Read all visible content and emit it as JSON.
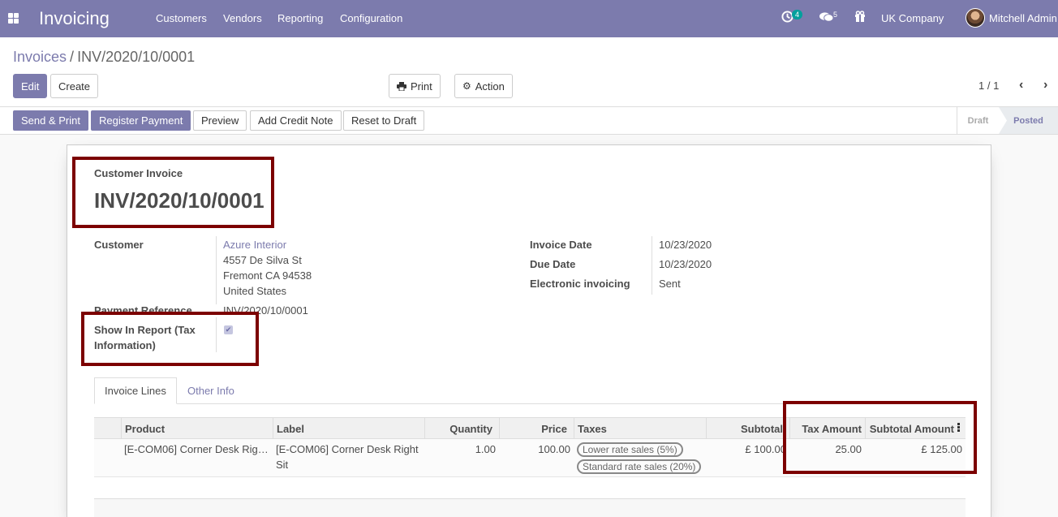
{
  "nav": {
    "brand": "Invoicing",
    "menu": [
      "Customers",
      "Vendors",
      "Reporting",
      "Configuration"
    ],
    "activity_count": "4",
    "message_count": "5",
    "company": "UK Company",
    "user": "Mitchell Admin"
  },
  "breadcrumb": {
    "parent": "Invoices",
    "current": "INV/2020/10/0001"
  },
  "toolbar": {
    "edit": "Edit",
    "create": "Create",
    "print": "Print",
    "action": "Action",
    "pager": "1 / 1"
  },
  "statusbar": {
    "buttons": [
      "Send & Print",
      "Register Payment",
      "Preview",
      "Add Credit Note",
      "Reset to Draft"
    ],
    "stages": [
      "Draft",
      "Posted"
    ]
  },
  "invoice": {
    "type_label": "Customer Invoice",
    "number": "INV/2020/10/0001",
    "customer_label": "Customer",
    "customer_name": "Azure Interior",
    "address": [
      "4557 De Silva St",
      "Fremont CA 94538",
      "United States"
    ],
    "payment_ref_label": "Payment Reference",
    "payment_ref": "INV/2020/10/0001",
    "show_report_label_1": "Show In Report (Tax",
    "show_report_label_2": "Information)",
    "invoice_date_label": "Invoice Date",
    "invoice_date": "10/23/2020",
    "due_date_label": "Due Date",
    "due_date": "10/23/2020",
    "einvoice_label": "Electronic invoicing",
    "einvoice": "Sent"
  },
  "tabs": [
    "Invoice Lines",
    "Other Info"
  ],
  "lines": {
    "headers": [
      "Product",
      "Label",
      "Quantity",
      "Price",
      "Taxes",
      "Subtotal",
      "Tax Amount",
      "Subtotal Amount"
    ],
    "rows": [
      {
        "product": "[E-COM06] Corner Desk Rig…",
        "label_1": "[E-COM06] Corner Desk Right",
        "label_2": "Sit",
        "quantity": "1.00",
        "price": "100.00",
        "taxes": [
          "Lower rate sales (5%)",
          "Standard rate sales (20%)"
        ],
        "subtotal": "£ 100.00",
        "tax_amount": "25.00",
        "subtotal_amount": "£ 125.00"
      }
    ]
  },
  "colors": {
    "brand": "#7c7bad",
    "highlight": "#7c0000"
  }
}
